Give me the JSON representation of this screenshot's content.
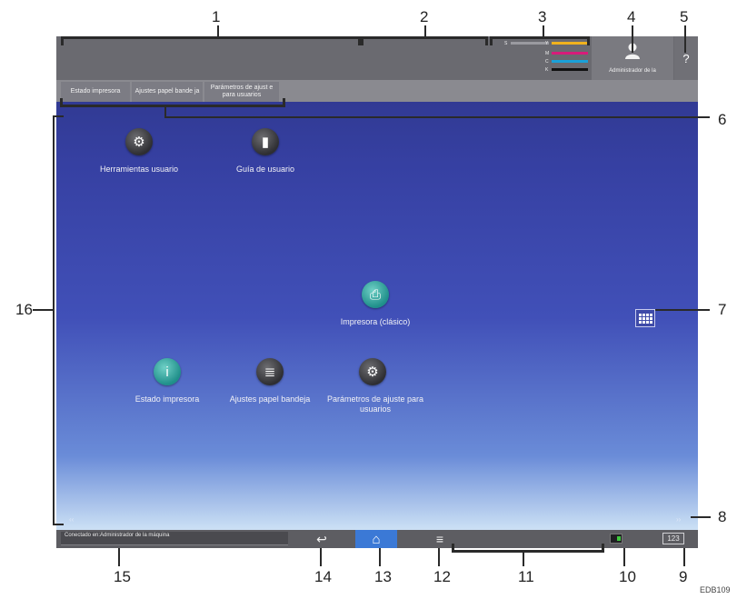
{
  "callouts": [
    "1",
    "2",
    "3",
    "4",
    "5",
    "6",
    "7",
    "8",
    "9",
    "10",
    "11",
    "12",
    "13",
    "14",
    "15",
    "16"
  ],
  "figure_code": "EDB109",
  "topbar": {
    "toner_labels": [
      "S",
      "Y",
      "M",
      "C",
      "K"
    ],
    "toner_colors": {
      "Y": "#f0b21e",
      "M": "#d81c7a",
      "C": "#1aa0d8",
      "K": "#111111"
    },
    "user_label": "Administrador de la",
    "help_glyph": "?"
  },
  "tabs": [
    {
      "label": "Estado impresora"
    },
    {
      "label": "Ajustes papel bande ja"
    },
    {
      "label": "Parámetros de ajust e para usuarios"
    }
  ],
  "apps": [
    {
      "label": "Herramientas usuario",
      "icon": "gears-icon"
    },
    {
      "label": "Guía de usuario",
      "icon": "book-icon"
    },
    {
      "label": "Impresora (clásico)",
      "icon": "printer-icon"
    },
    {
      "label": "Estado impresora",
      "icon": "info-icon"
    },
    {
      "label": "Ajustes papel bandeja",
      "icon": "tray-settings-icon"
    },
    {
      "label": "Parámetros de ajuste para usuarios",
      "icon": "user-settings-icon"
    }
  ],
  "bottombar": {
    "status_text": "Conectado en:Administrador de la máquina",
    "counter_label": "123"
  },
  "colors": {
    "home_button": "#3b79d6",
    "topbar": "#6a6a70"
  }
}
